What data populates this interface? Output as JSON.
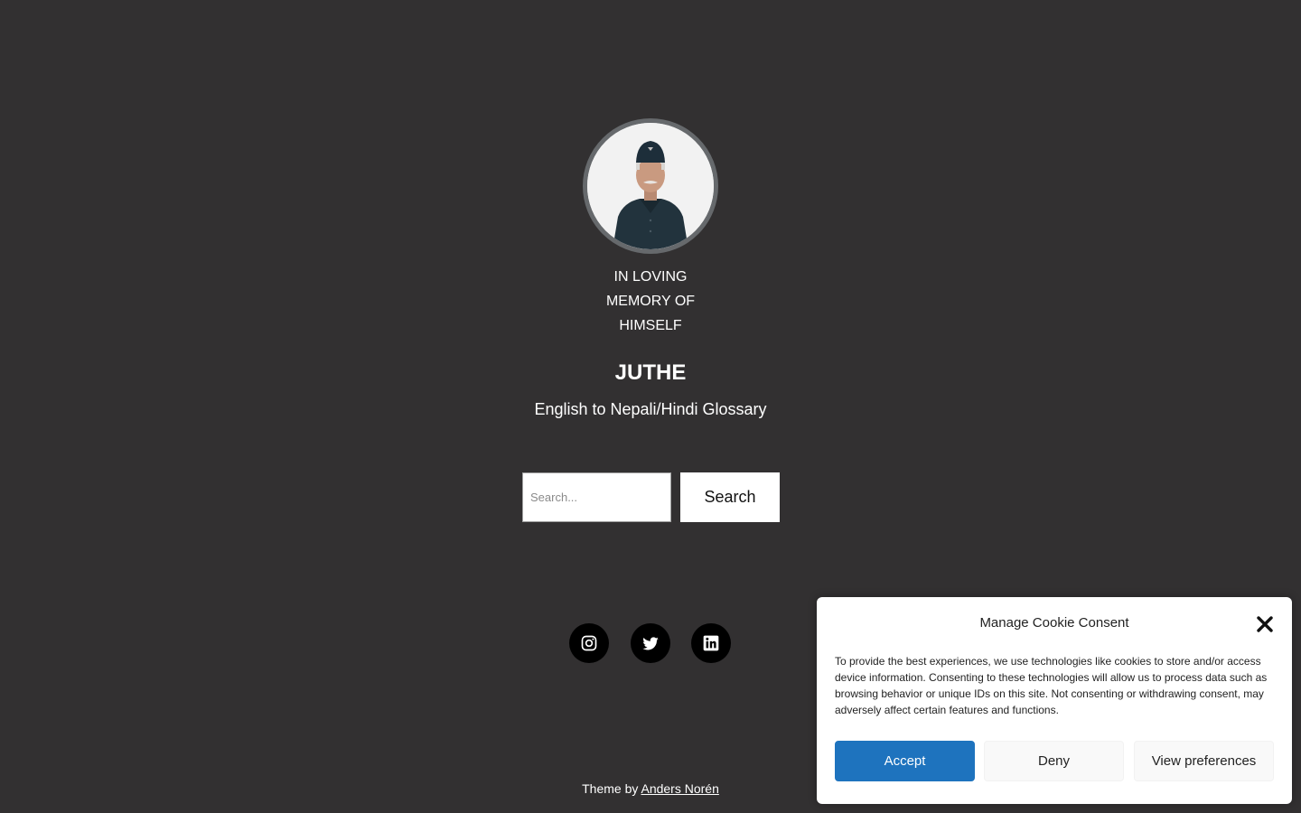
{
  "header": {
    "memory_lines": [
      "IN LOVING",
      "MEMORY OF",
      "HIMSELF"
    ],
    "site_title": "JUTHE",
    "site_description": "English to Nepali/Hindi Glossary"
  },
  "search": {
    "placeholder": "Search...",
    "value": "",
    "button_label": "Search"
  },
  "social": [
    {
      "name": "instagram-icon"
    },
    {
      "name": "twitter-icon"
    },
    {
      "name": "linkedin-icon"
    }
  ],
  "footer": {
    "credit_prefix": "Theme by",
    "credit_link": "Anders Norén"
  },
  "cookie_banner": {
    "title": "Manage Cookie Consent",
    "body": "To provide the best experiences, we use technologies like cookies to store and/or access device information. Consenting to these technologies will allow us to process data such as browsing behavior or unique IDs on this site. Not consenting or withdrawing consent, may adversely affect certain features and functions.",
    "accept_label": "Accept",
    "deny_label": "Deny",
    "preferences_label": "View preferences",
    "close_icon": "close-icon"
  },
  "colors": {
    "background": "#323031",
    "accept_button": "#1e73be",
    "social_circle": "#000000"
  }
}
